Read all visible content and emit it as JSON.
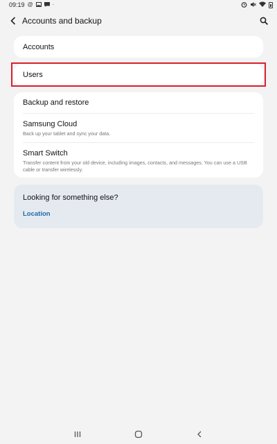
{
  "status_bar": {
    "time": "09:19",
    "left_icons": [
      "at-icon",
      "image-icon",
      "message-icon",
      "dot-icon"
    ],
    "right_icons": [
      "alarm-icon",
      "mute-icon",
      "wifi-icon",
      "battery-icon"
    ]
  },
  "app_bar": {
    "title": "Accounts and backup",
    "back_icon": "chevron-left-icon",
    "search_icon": "search-icon"
  },
  "items": {
    "accounts": {
      "label": "Accounts"
    },
    "users": {
      "label": "Users"
    }
  },
  "backup_group": {
    "backup_restore": {
      "title": "Backup and restore"
    },
    "samsung_cloud": {
      "title": "Samsung Cloud",
      "subtitle": "Back up your tablet and sync your data."
    },
    "smart_switch": {
      "title": "Smart Switch",
      "subtitle": "Transfer content from your old device, including images, contacts, and messages. You can use a USB cable or transfer wirelessly."
    }
  },
  "looking_else": {
    "title": "Looking for something else?",
    "link": "Location"
  },
  "colors": {
    "background": "#f3f3f3",
    "card": "#ffffff",
    "highlight": "#d91f2b",
    "link": "#1d6aa8",
    "suggest_card": "#e5eaf0"
  },
  "nav_bar": {
    "recents_icon": "recents-icon",
    "home_icon": "home-icon",
    "back_icon": "back-icon"
  }
}
